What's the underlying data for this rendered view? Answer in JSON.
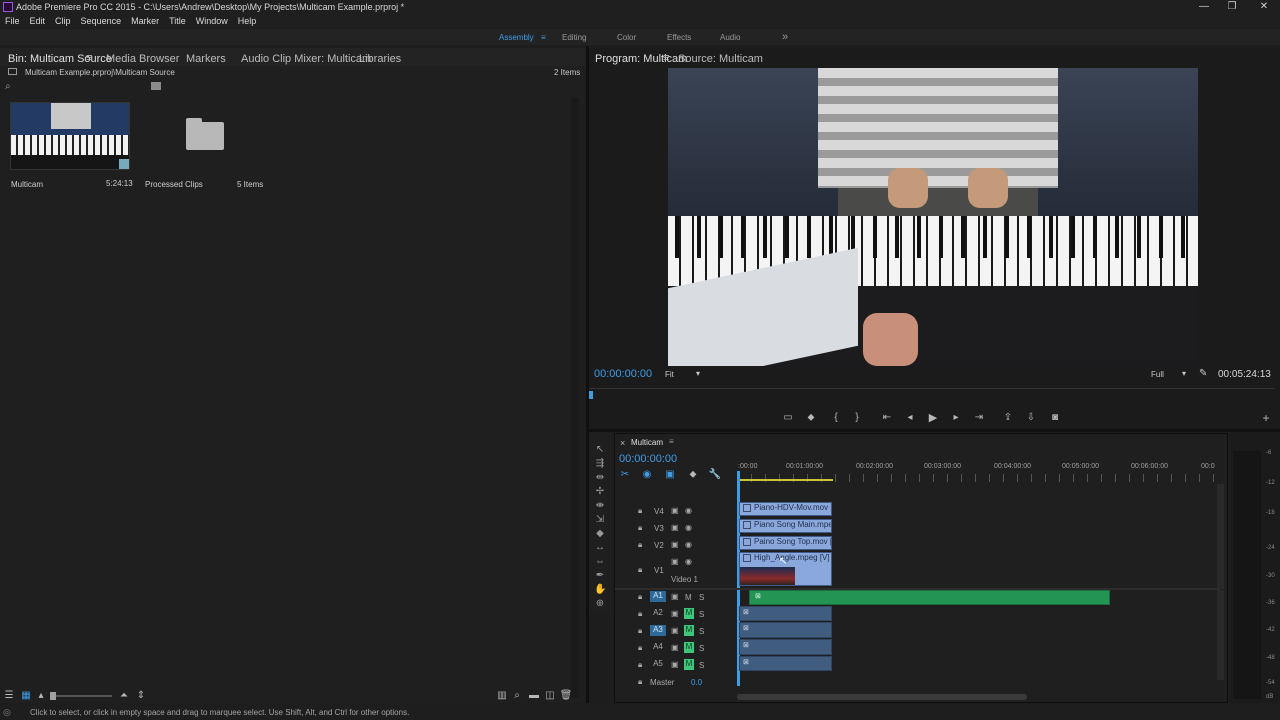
{
  "window": {
    "title": "Adobe Premiere Pro CC 2015 - C:\\Users\\Andrew\\Desktop\\My Projects\\Multicam Example.prproj *"
  },
  "menu": [
    "File",
    "Edit",
    "Clip",
    "Sequence",
    "Marker",
    "Title",
    "Window",
    "Help"
  ],
  "workspaces": {
    "items": [
      "Assembly",
      "Editing",
      "Color",
      "Effects",
      "Audio"
    ],
    "active": "Assembly",
    "overflow": "»"
  },
  "left_panel": {
    "tabs": [
      "Bin: Multicam Source",
      "Media Browser",
      "Markers",
      "Audio Clip Mixer: Multicam",
      "Libraries"
    ],
    "path": "Multicam Example.prproj\\Multicam Source",
    "item_count": "2 Items",
    "items": [
      {
        "name": "Multicam",
        "duration": "5:24:13"
      },
      {
        "name": "Processed Clips",
        "count": "5 Items"
      }
    ]
  },
  "program": {
    "tabs": [
      "Program: Multicam",
      "Source: Multicam"
    ],
    "timecode": "00:00:00:00",
    "fit": "Fit",
    "quality": "Full",
    "duration": "00:05:24:13"
  },
  "timeline": {
    "tab": "Multicam",
    "timecode": "00:00:00:00",
    "ruler": [
      ":00:00",
      "00:01:00:00",
      "00:02:00:00",
      "00:03:00:00",
      "00:04:00:00",
      "00:05:00:00",
      "00:06:00:00",
      "00:0"
    ],
    "video_tracks": [
      {
        "id": "V4",
        "clip": "Piano-HDV-Mov.mov [V]"
      },
      {
        "id": "V3",
        "clip": "Piano Song Main.mpeg [V]"
      },
      {
        "id": "V2",
        "clip": "Paino Song Top.mov [V]"
      },
      {
        "id": "V1",
        "label": "Video 1",
        "clip": "High_Angle.mpeg [V]"
      }
    ],
    "audio_tracks": [
      {
        "id": "A1",
        "m": "M",
        "s": "S"
      },
      {
        "id": "A2",
        "m": "M",
        "s": "S"
      },
      {
        "id": "A3",
        "m": "M",
        "s": "S"
      },
      {
        "id": "A4",
        "m": "M",
        "s": "S"
      },
      {
        "id": "A5",
        "m": "M",
        "s": "S"
      }
    ],
    "master": {
      "label": "Master",
      "value": "0.0"
    }
  },
  "meter_labels": [
    "-6",
    "-12",
    "-18",
    "-24",
    "-30",
    "-36",
    "-42",
    "-48",
    "-54",
    "dB"
  ],
  "status": "Click to select, or click in empty space and drag to marquee select. Use Shift, Alt, and Ctrl for other options.",
  "colors": {
    "accent": "#3f9de8",
    "video_clip": "#8ba8dd",
    "audio_clip": "#405c7f",
    "audio_green_clip": "#239454",
    "mute_green": "#3ec77a"
  }
}
